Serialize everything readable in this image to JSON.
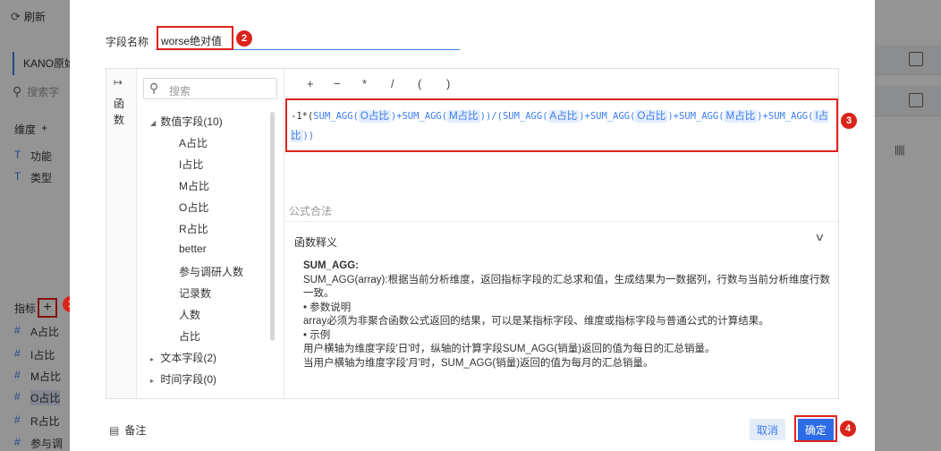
{
  "background": {
    "refresh_label": "刷新",
    "dataset_name": "KANO原始",
    "search_placeholder": "搜索字",
    "dimension_title": "维度",
    "dimension_fields": [
      "功能",
      "类型"
    ],
    "metric_title": "指标",
    "metric_fields": [
      "A占比",
      "I占比",
      "M占比",
      "O占比",
      "R占比",
      "参与调"
    ],
    "field_prefix": "#",
    "dim_prefix": "T"
  },
  "modal": {
    "field_name_label": "字段名称",
    "field_name_value": "worse绝对值",
    "function_panel_label": "函数",
    "search_placeholder": "搜索",
    "tree": {
      "numeric_group": "数值字段(10)",
      "numeric_fields": [
        "A占比",
        "I占比",
        "M占比",
        "O占比",
        "R占比",
        "better",
        "参与调研人数",
        "记录数",
        "人数",
        "占比"
      ],
      "text_group": "文本字段(2)",
      "time_group": "时间字段(0)"
    },
    "operators": [
      "+",
      "−",
      "*",
      "/",
      "(",
      ")"
    ],
    "formula": {
      "parts": [
        {
          "t": "-1*(",
          "k": "plain"
        },
        {
          "t": "SUM_AGG(",
          "k": "fn"
        },
        {
          "t": "O占比",
          "k": "tok"
        },
        {
          "t": ")+",
          "k": "fn"
        },
        {
          "t": "SUM_AGG(",
          "k": "fn"
        },
        {
          "t": "M占比",
          "k": "tok"
        },
        {
          "t": "))/(",
          "k": "fn"
        },
        {
          "t": "SUM_AGG(",
          "k": "fn"
        },
        {
          "t": "A占比",
          "k": "tok"
        },
        {
          "t": ")+",
          "k": "fn"
        },
        {
          "t": "SUM_AGG(",
          "k": "fn"
        },
        {
          "t": "O占比",
          "k": "tok"
        },
        {
          "t": ")+",
          "k": "fn"
        },
        {
          "t": "SUM_AGG(",
          "k": "fn"
        },
        {
          "t": "M占比",
          "k": "tok"
        },
        {
          "t": ")+",
          "k": "fn"
        },
        {
          "t": "SUM_AGG(",
          "k": "fn"
        },
        {
          "t": "I占比",
          "k": "tok"
        },
        {
          "t": "))",
          "k": "fn"
        }
      ]
    },
    "formula_status": "公式合法",
    "explain_title": "函数释义",
    "explain": {
      "name": "SUM_AGG:",
      "desc": "SUM_AGG(array):根据当前分析维度，返回指标字段的汇总求和值，生成结果为一数据列，行数与当前分析维度行数一致。",
      "param_title": "• 参数说明",
      "param_desc": "array必须为非聚合函数公式返回的结果，可以是某指标字段、维度或指标字段与普通公式的计算结果。",
      "example_title": "• 示例",
      "example_1": "用户横轴为维度字段'日'时，纵轴的计算字段SUM_AGG(销量)返回的值为每日的汇总销量。",
      "example_2": "当用户横轴为维度字段'月'时，SUM_AGG(销量)返回的值为每月的汇总销量。"
    },
    "remark_label": "备注",
    "cancel_label": "取消",
    "confirm_label": "确定"
  },
  "annotations": [
    "1",
    "2",
    "3",
    "4"
  ],
  "colors": {
    "accent": "#3c7cf0",
    "highlight_red": "#e0221b",
    "badge_red": "#d9241c"
  }
}
